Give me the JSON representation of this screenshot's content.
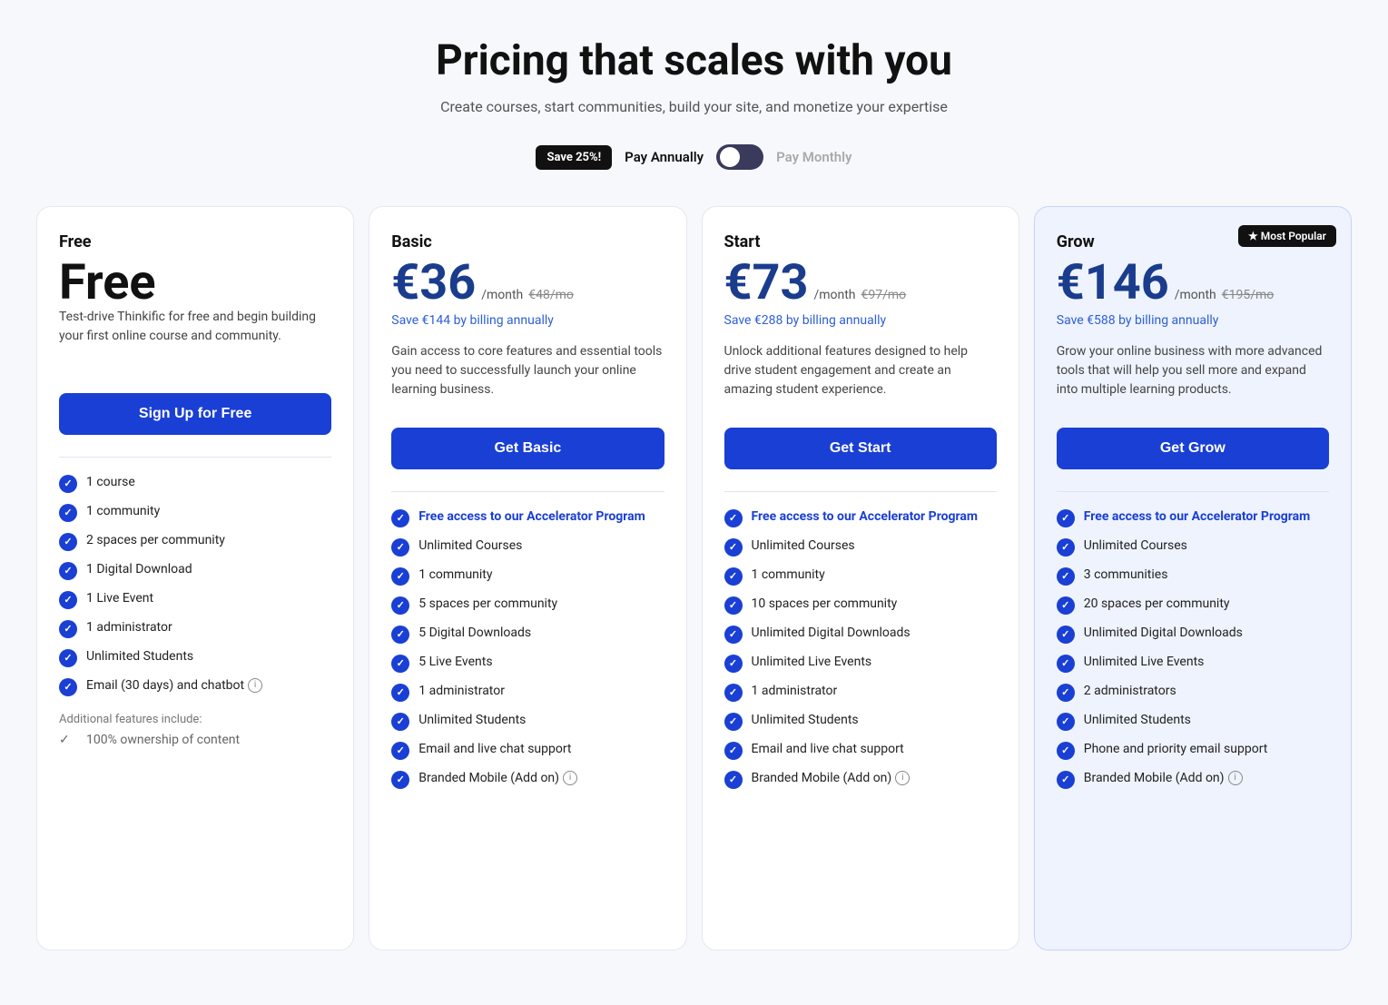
{
  "header": {
    "title": "Pricing that scales with you",
    "subtitle": "Create courses, start communities, build your site, and monetize your expertise"
  },
  "billing": {
    "save_badge": "Save 25%!",
    "annual_label": "Pay Annually",
    "monthly_label": "Pay Monthly"
  },
  "plans": [
    {
      "id": "free",
      "name": "Free",
      "price": "Free",
      "price_period": "",
      "price_original": "",
      "save_text": "",
      "description": "Test-drive Thinkific for free and begin building your first online course and community.",
      "cta": "Sign Up for Free",
      "most_popular": false,
      "highlighted": false,
      "features": [
        {
          "text": "1 course",
          "type": "check"
        },
        {
          "text": "1 community",
          "type": "check"
        },
        {
          "text": "2 spaces per community",
          "type": "check"
        },
        {
          "text": "1 Digital Download",
          "type": "check"
        },
        {
          "text": "1 Live Event",
          "type": "check"
        },
        {
          "text": "1 administrator",
          "type": "check"
        },
        {
          "text": "Unlimited Students",
          "type": "check"
        },
        {
          "text": "Email (30 days) and chatbot",
          "type": "check",
          "info": true
        }
      ],
      "additional_label": "Additional features include:",
      "additional_features": [
        {
          "text": "100% ownership of content",
          "type": "simple-check"
        }
      ]
    },
    {
      "id": "basic",
      "name": "Basic",
      "price": "€36",
      "price_period": "/month",
      "price_original": "€48/mo",
      "save_text": "Save €144 by billing annually",
      "description": "Gain access to core features and essential tools you need to successfully launch your online learning business.",
      "cta": "Get Basic",
      "most_popular": false,
      "highlighted": false,
      "features": [
        {
          "text": "Free access to our Accelerator Program",
          "type": "accelerator"
        },
        {
          "text": "Unlimited Courses",
          "type": "check"
        },
        {
          "text": "1 community",
          "type": "check"
        },
        {
          "text": "5 spaces per community",
          "type": "check"
        },
        {
          "text": "5 Digital Downloads",
          "type": "check"
        },
        {
          "text": "5 Live Events",
          "type": "check"
        },
        {
          "text": "1 administrator",
          "type": "check"
        },
        {
          "text": "Unlimited Students",
          "type": "check"
        },
        {
          "text": "Email and live chat support",
          "type": "check"
        },
        {
          "text": "Branded Mobile (Add on)",
          "type": "check",
          "info": true
        }
      ]
    },
    {
      "id": "start",
      "name": "Start",
      "price": "€73",
      "price_period": "/month",
      "price_original": "€97/mo",
      "save_text": "Save €288 by billing annually",
      "description": "Unlock additional features designed to help drive student engagement and create an amazing student experience.",
      "cta": "Get Start",
      "most_popular": false,
      "highlighted": false,
      "features": [
        {
          "text": "Free access to our Accelerator Program",
          "type": "accelerator"
        },
        {
          "text": "Unlimited Courses",
          "type": "check"
        },
        {
          "text": "1 community",
          "type": "check"
        },
        {
          "text": "10 spaces per community",
          "type": "check"
        },
        {
          "text": "Unlimited Digital Downloads",
          "type": "check"
        },
        {
          "text": "Unlimited Live Events",
          "type": "check"
        },
        {
          "text": "1 administrator",
          "type": "check"
        },
        {
          "text": "Unlimited Students",
          "type": "check"
        },
        {
          "text": "Email and live chat support",
          "type": "check"
        },
        {
          "text": "Branded Mobile (Add on)",
          "type": "check",
          "info": true
        }
      ]
    },
    {
      "id": "grow",
      "name": "Grow",
      "price": "€146",
      "price_period": "/month",
      "price_original": "€195/mo",
      "save_text": "Save €588 by billing annually",
      "description": "Grow your online business with more advanced tools that will help you sell more and expand into multiple learning products.",
      "cta": "Get Grow",
      "most_popular": true,
      "highlighted": true,
      "features": [
        {
          "text": "Free access to our Accelerator Program",
          "type": "accelerator"
        },
        {
          "text": "Unlimited Courses",
          "type": "check"
        },
        {
          "text": "3 communities",
          "type": "check"
        },
        {
          "text": "20 spaces per community",
          "type": "check"
        },
        {
          "text": "Unlimited Digital Downloads",
          "type": "check"
        },
        {
          "text": "Unlimited Live Events",
          "type": "check"
        },
        {
          "text": "2 administrators",
          "type": "check"
        },
        {
          "text": "Unlimited Students",
          "type": "check"
        },
        {
          "text": "Phone and priority email support",
          "type": "check"
        },
        {
          "text": "Branded Mobile (Add on)",
          "type": "check",
          "info": true
        }
      ]
    }
  ]
}
